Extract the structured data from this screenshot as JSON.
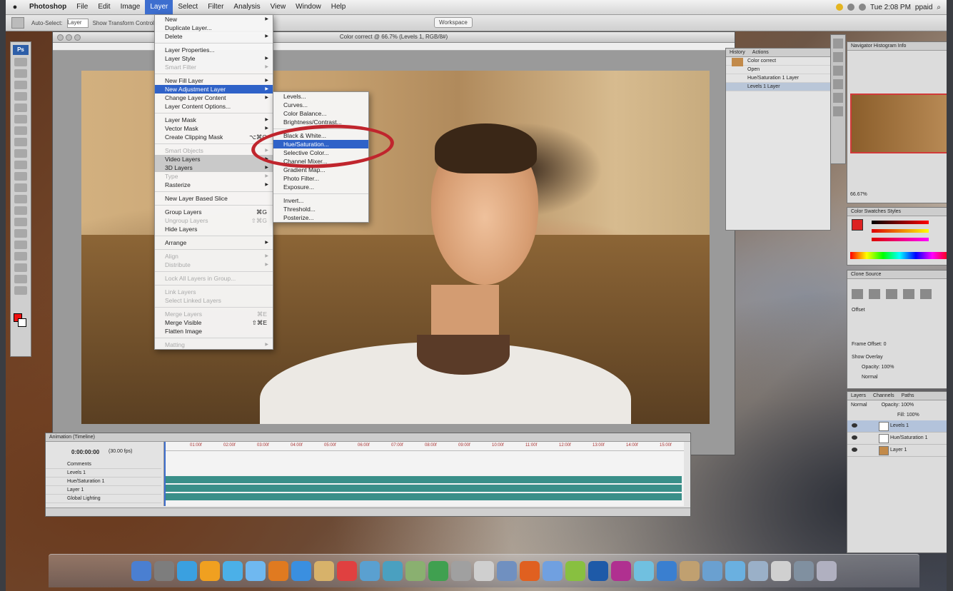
{
  "menubar": {
    "items": [
      "Photoshop",
      "File",
      "Edit",
      "Image",
      "Layer",
      "Select",
      "Filter",
      "Analysis",
      "View",
      "Window",
      "Help"
    ],
    "clock": "Tue 2:08 PM",
    "user": "ppaid"
  },
  "options_bar": {
    "auto_select_label": "Auto-Select:",
    "auto_select_value": "Layer",
    "show_transform": "Show Transform Controls",
    "workspace": "Workspace"
  },
  "tools": {
    "logo": "Ps"
  },
  "document": {
    "title": "Color correct @ 66.7% (Levels 1, RGB/8#)"
  },
  "layer_menu": [
    {
      "label": "New",
      "arrow": true
    },
    {
      "label": "Duplicate Layer..."
    },
    {
      "label": "Delete",
      "arrow": true
    },
    {
      "sep": true
    },
    {
      "label": "Layer Properties..."
    },
    {
      "label": "Layer Style",
      "arrow": true
    },
    {
      "label": "Smart Filter",
      "arrow": true,
      "dis": true
    },
    {
      "sep": true
    },
    {
      "label": "New Fill Layer",
      "arrow": true
    },
    {
      "label": "New Adjustment Layer",
      "arrow": true,
      "sel": true
    },
    {
      "label": "Change Layer Content",
      "arrow": true
    },
    {
      "label": "Layer Content Options..."
    },
    {
      "sep": true
    },
    {
      "label": "Layer Mask",
      "arrow": true
    },
    {
      "label": "Vector Mask",
      "arrow": true
    },
    {
      "label": "Create Clipping Mask",
      "sc": "⌥⌘G"
    },
    {
      "sep": true
    },
    {
      "label": "Smart Objects",
      "arrow": true,
      "dis": true
    },
    {
      "label": "Video Layers",
      "arrow": true,
      "grey": true
    },
    {
      "label": "3D Layers",
      "arrow": true,
      "grey": true
    },
    {
      "label": "Type",
      "arrow": true,
      "dis": true
    },
    {
      "label": "Rasterize",
      "arrow": true
    },
    {
      "sep": true
    },
    {
      "label": "New Layer Based Slice"
    },
    {
      "sep": true
    },
    {
      "label": "Group Layers",
      "sc": "⌘G"
    },
    {
      "label": "Ungroup Layers",
      "sc": "⇧⌘G",
      "dis": true
    },
    {
      "label": "Hide Layers"
    },
    {
      "sep": true
    },
    {
      "label": "Arrange",
      "arrow": true
    },
    {
      "sep": true
    },
    {
      "label": "Align",
      "arrow": true,
      "dis": true
    },
    {
      "label": "Distribute",
      "arrow": true,
      "dis": true
    },
    {
      "sep": true
    },
    {
      "label": "Lock All Layers in Group...",
      "dis": true
    },
    {
      "sep": true
    },
    {
      "label": "Link Layers",
      "dis": true
    },
    {
      "label": "Select Linked Layers",
      "dis": true
    },
    {
      "sep": true
    },
    {
      "label": "Merge Layers",
      "sc": "⌘E",
      "dis": true
    },
    {
      "label": "Merge Visible",
      "sc": "⇧⌘E"
    },
    {
      "label": "Flatten Image"
    },
    {
      "sep": true
    },
    {
      "label": "Matting",
      "arrow": true,
      "dis": true
    }
  ],
  "adjustment_menu": [
    {
      "label": "Levels..."
    },
    {
      "label": "Curves..."
    },
    {
      "label": "Color Balance..."
    },
    {
      "label": "Brightness/Contrast..."
    },
    {
      "sep": true
    },
    {
      "label": "Black & White..."
    },
    {
      "label": "Hue/Saturation...",
      "sel": true
    },
    {
      "label": "Selective Color..."
    },
    {
      "label": "Channel Mixer..."
    },
    {
      "label": "Gradient Map..."
    },
    {
      "label": "Photo Filter..."
    },
    {
      "label": "Exposure..."
    },
    {
      "sep": true
    },
    {
      "label": "Invert..."
    },
    {
      "label": "Threshold..."
    },
    {
      "label": "Posterize..."
    }
  ],
  "history_panel": {
    "tabs": [
      "History",
      "Actions"
    ],
    "items": [
      "Color correct",
      "Open",
      "Hue/Saturation 1 Layer",
      "Levels 1 Layer"
    ]
  },
  "navigator_panel": {
    "tabs": "Navigator  Histogram  Info",
    "zoom": "66.67%"
  },
  "color_panel": {
    "tabs": "Color  Swatches  Styles"
  },
  "adjustments_panel": {
    "tabs": "Clone Source",
    "offset_label": "Offset",
    "frame_offset": "Frame Offset: 0",
    "show_overlay": "Show Overlay",
    "opacity": "Opacity: 100%",
    "normal": "Normal"
  },
  "layers_panel": {
    "tabs": [
      "Layers",
      "Channels",
      "Paths"
    ],
    "blend": "Normal",
    "opacity": "Opacity: 100%",
    "fill": "Fill: 100%",
    "layers": [
      {
        "name": "Levels 1",
        "sel": true
      },
      {
        "name": "Hue/Saturation 1",
        "sel": false
      },
      {
        "name": "Layer 1",
        "sel": false
      }
    ]
  },
  "animation_panel": {
    "tab": "Animation (Timeline)",
    "time": "0:00:00:00",
    "fps": "(30.00 fps)",
    "rows": [
      "Comments",
      "Levels 1",
      "Hue/Saturation 1",
      "Layer 1",
      "Global Lighting"
    ],
    "ticks": [
      "01:00f",
      "02:00f",
      "03:00f",
      "04:00f",
      "05:00f",
      "06:00f",
      "07:00f",
      "08:00f",
      "09:00f",
      "10:00f",
      "11:00f",
      "12:00f",
      "13:00f",
      "14:00f",
      "15:00f"
    ]
  },
  "colors": {
    "accent": "#2f62c8",
    "highlight_circle": "#c0252d",
    "timeline_bar": "#3a8f89"
  }
}
